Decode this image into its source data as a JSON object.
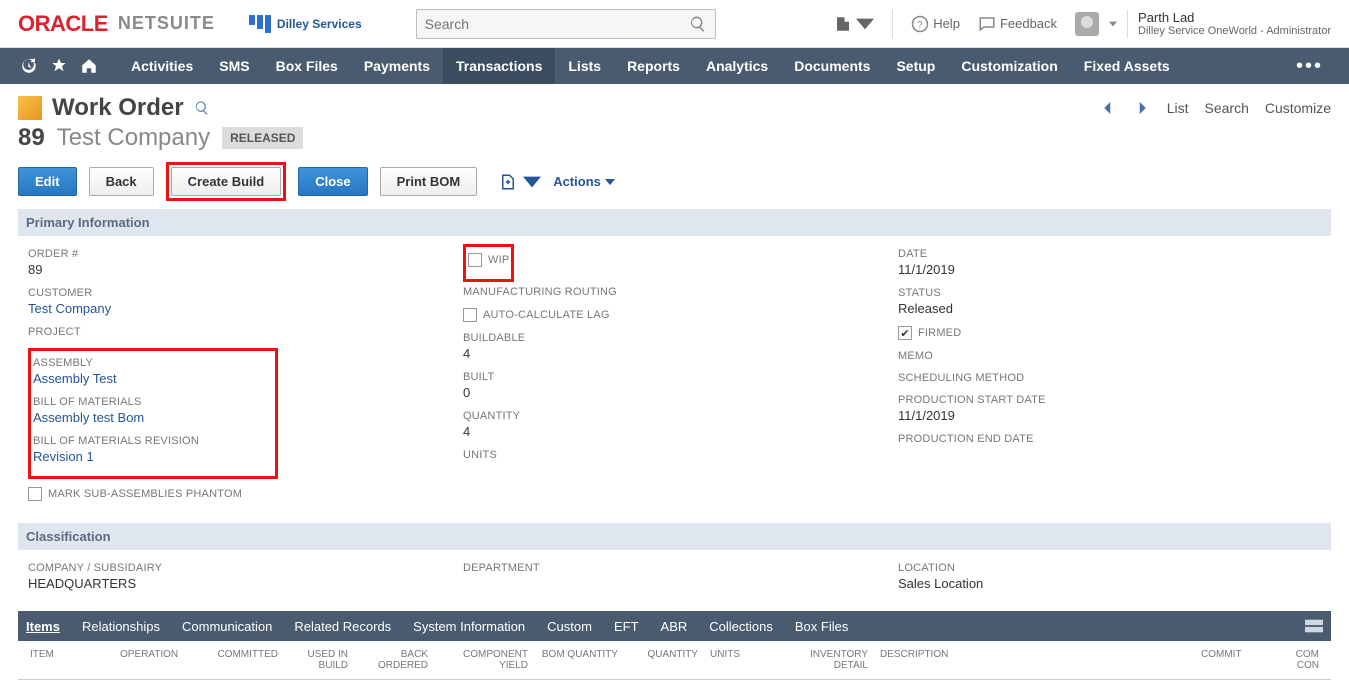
{
  "brand": {
    "oracle": "ORACLE",
    "netsuite": "NETSUITE",
    "org": "Dilley Services"
  },
  "search": {
    "placeholder": "Search"
  },
  "topright": {
    "help": "Help",
    "feedback": "Feedback"
  },
  "user": {
    "name": "Parth Lad",
    "role": "Dilley Service OneWorld - Administrator"
  },
  "nav": {
    "items": [
      "Activities",
      "SMS",
      "Box Files",
      "Payments",
      "Transactions",
      "Lists",
      "Reports",
      "Analytics",
      "Documents",
      "Setup",
      "Customization",
      "Fixed Assets"
    ],
    "active": "Transactions"
  },
  "page": {
    "title": "Work Order",
    "number": "89",
    "customer": "Test Company",
    "status_badge": "RELEASED",
    "buttons": {
      "edit": "Edit",
      "back": "Back",
      "create_build": "Create Build",
      "close": "Close",
      "print_bom": "Print BOM",
      "actions": "Actions"
    },
    "right": {
      "list": "List",
      "search": "Search",
      "customize": "Customize"
    }
  },
  "primary": {
    "title": "Primary Information",
    "left": {
      "order": {
        "label": "ORDER #",
        "value": "89"
      },
      "customer": {
        "label": "CUSTOMER",
        "value": "Test Company"
      },
      "project": {
        "label": "PROJECT",
        "value": ""
      },
      "assembly": {
        "label": "ASSEMBLY",
        "value": "Assembly Test"
      },
      "bom": {
        "label": "BILL OF MATERIALS",
        "value": "Assembly test Bom"
      },
      "bomrev": {
        "label": "BILL OF MATERIALS REVISION",
        "value": "Revision 1"
      },
      "phantom": {
        "label": "MARK SUB-ASSEMBLIES PHANTOM",
        "checked": false
      }
    },
    "mid": {
      "wip": {
        "label": "WIP",
        "checked": false
      },
      "routing": {
        "label": "MANUFACTURING ROUTING",
        "value": ""
      },
      "autolag": {
        "label": "AUTO-CALCULATE LAG",
        "checked": false
      },
      "buildable": {
        "label": "BUILDABLE",
        "value": "4"
      },
      "built": {
        "label": "BUILT",
        "value": "0"
      },
      "quantity": {
        "label": "QUANTITY",
        "value": "4"
      },
      "units": {
        "label": "UNITS",
        "value": ""
      }
    },
    "right": {
      "date": {
        "label": "DATE",
        "value": "11/1/2019"
      },
      "status": {
        "label": "STATUS",
        "value": "Released"
      },
      "firmed": {
        "label": "FIRMED",
        "checked": true
      },
      "memo": {
        "label": "MEMO",
        "value": ""
      },
      "sched": {
        "label": "SCHEDULING METHOD",
        "value": ""
      },
      "pstart": {
        "label": "PRODUCTION START DATE",
        "value": "11/1/2019"
      },
      "pend": {
        "label": "PRODUCTION END DATE",
        "value": ""
      }
    }
  },
  "classification": {
    "title": "Classification",
    "company": {
      "label": "COMPANY / SUBSIDAIRY",
      "value": "HEADQUARTERS"
    },
    "department": {
      "label": "DEPARTMENT",
      "value": ""
    },
    "location": {
      "label": "LOCATION",
      "value": "Sales Location"
    }
  },
  "tabs": [
    "Items",
    "Relationships",
    "Communication",
    "Related Records",
    "System Information",
    "Custom",
    "EFT",
    "ABR",
    "Collections",
    "Box Files"
  ],
  "tab_active": "Items",
  "thead": {
    "item": "ITEM",
    "op": "OPERATION",
    "committed": "COMMITTED",
    "uib": "USED IN BUILD",
    "bo": "BACK ORDERED",
    "cy": "COMPONENT YIELD",
    "bq": "BOM QUANTITY",
    "qty": "QUANTITY",
    "units": "UNITS",
    "inv": "INVENTORY DETAIL",
    "desc": "DESCRIPTION",
    "commit": "COMMIT",
    "con": "COM CON"
  }
}
